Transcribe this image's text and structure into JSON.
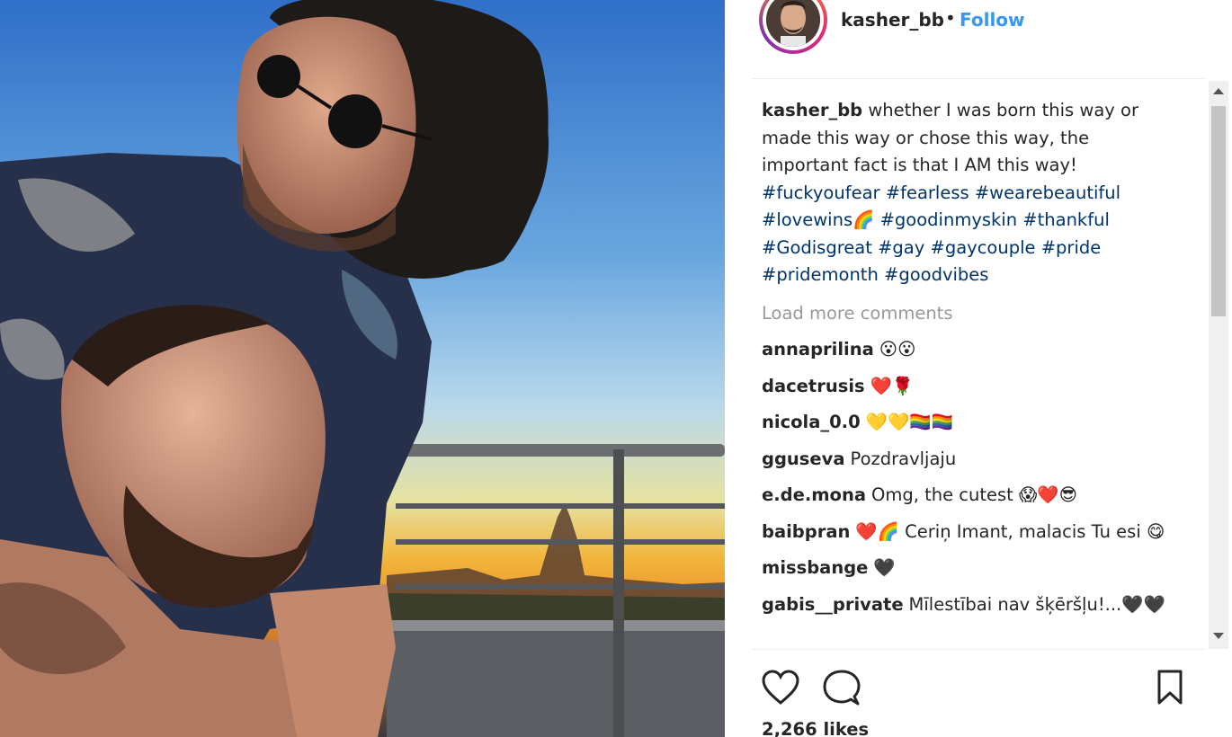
{
  "post": {
    "username": "kasher_bb",
    "separator": "•",
    "follow_label": "Follow",
    "caption": {
      "username": "kasher_bb",
      "text_line1": " whether I was born this way or",
      "text_line2": "made this way or chose this way, the",
      "text_line3": "important fact is that I AM this way!",
      "tags_line1": "#fuckyoufear #fearless #wearebeautiful",
      "tags_line2": "#lovewins🌈 #goodinmyskin #thankful",
      "tags_line3": "#Godisgreat #gay #gaycouple #pride",
      "tags_line4": "#pridemonth #goodvibes"
    },
    "load_more": "Load more comments",
    "comments": [
      {
        "user": "annaprilina",
        "text": "😮😮"
      },
      {
        "user": "dacetrusis",
        "text": "❤️🌹"
      },
      {
        "user": "nicola_0.0",
        "text": "💛💛🏳️‍🌈🏳️‍🌈"
      },
      {
        "user": "gguseva",
        "text": "Pozdravljaju"
      },
      {
        "user": "e.de.mona",
        "text": "Omg, the cutest 😱❤️😎"
      },
      {
        "user": "baibpran",
        "text": "❤️🌈 Ceriņ Imant, malacis Tu esi 😋"
      },
      {
        "user": "missbange",
        "text": "🖤"
      },
      {
        "user": "gabis__private",
        "text": "Mīlestībai nav šķēršļu!...🖤🖤"
      }
    ],
    "likes": "2,266 likes"
  },
  "icons": {
    "like": "heart-icon",
    "comment": "comment-icon",
    "save": "bookmark-icon"
  }
}
